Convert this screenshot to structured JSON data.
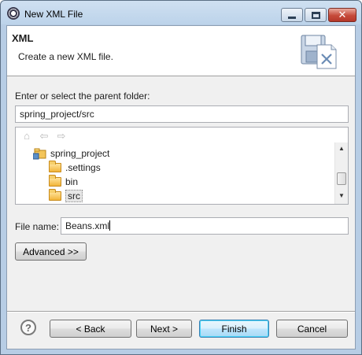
{
  "window": {
    "title": "New XML File",
    "controls": {
      "minimize": "minimize",
      "maximize": "maximize",
      "close": "✕"
    }
  },
  "banner": {
    "title": "XML",
    "description": "Create a new XML file.",
    "graphic_icon": "xml-wizard-icon"
  },
  "parent_folder": {
    "label": "Enter or select the parent folder:",
    "value": "spring_project/src"
  },
  "tree": {
    "toolbar": [
      {
        "name": "home-icon",
        "glyph": "⌂"
      },
      {
        "name": "back-arrow-icon",
        "glyph": "⇦"
      },
      {
        "name": "forward-arrow-icon",
        "glyph": "⇨"
      }
    ],
    "items": [
      {
        "label": ".settings"
      },
      {
        "label": "bin"
      },
      {
        "label": "src",
        "selected": true
      }
    ],
    "project": {
      "label": "spring_project"
    },
    "scroll_up": "▲",
    "scroll_down": "▼"
  },
  "file_name": {
    "label": "File name:",
    "value": "Beans.xml"
  },
  "advanced_button": "Advanced >>",
  "help_glyph": "?",
  "buttons": {
    "back": "< Back",
    "next": "Next >",
    "finish": "Finish",
    "cancel": "Cancel"
  }
}
